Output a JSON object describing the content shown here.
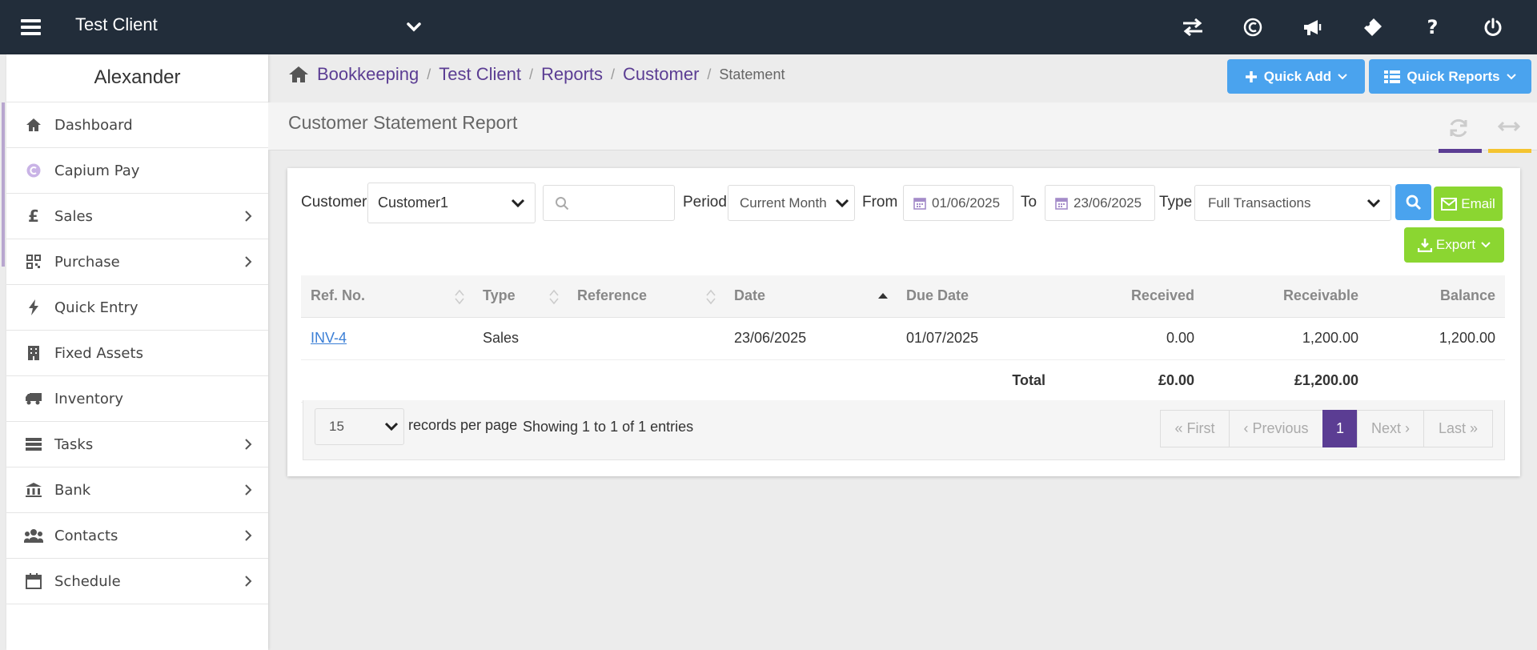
{
  "topbar": {
    "client_name": "Test Client",
    "icons": [
      "switch-icon",
      "capium-icon",
      "announcement-icon",
      "ticket-icon",
      "help-icon",
      "power-icon"
    ]
  },
  "sidebar": {
    "user": "Alexander",
    "items": [
      {
        "label": "Dashboard",
        "icon": "home-icon",
        "has_children": false
      },
      {
        "label": "Capium Pay",
        "icon": "capium-pay-icon",
        "has_children": false
      },
      {
        "label": "Sales",
        "icon": "pound-icon",
        "has_children": true
      },
      {
        "label": "Purchase",
        "icon": "qrcode-icon",
        "has_children": true
      },
      {
        "label": "Quick Entry",
        "icon": "bolt-icon",
        "has_children": false
      },
      {
        "label": "Fixed Assets",
        "icon": "building-icon",
        "has_children": false
      },
      {
        "label": "Inventory",
        "icon": "truck-icon",
        "has_children": false
      },
      {
        "label": "Tasks",
        "icon": "tasks-icon",
        "has_children": true
      },
      {
        "label": "Bank",
        "icon": "bank-icon",
        "has_children": true
      },
      {
        "label": "Contacts",
        "icon": "users-icon",
        "has_children": true
      },
      {
        "label": "Schedule",
        "icon": "calendar-icon",
        "has_children": true
      }
    ]
  },
  "breadcrumb": {
    "items": [
      "Bookkeeping",
      "Test Client",
      "Reports",
      "Customer"
    ],
    "current": "Statement"
  },
  "actions": {
    "quick_add": "Quick Add",
    "quick_reports": "Quick Reports"
  },
  "page": {
    "title": "Customer Statement Report"
  },
  "filters": {
    "customer_label": "Customer",
    "customer_value": "Customer1",
    "search_value": "",
    "period_label": "Period",
    "period_value": "Current Month",
    "from_label": "From",
    "from_value": "01/06/2025",
    "to_label": "To",
    "to_value": "23/06/2025",
    "type_label": "Type",
    "type_value": "Full Transactions",
    "email_label": "Email",
    "export_label": "Export"
  },
  "table": {
    "headers": [
      "Ref. No.",
      "Type",
      "Reference",
      "Date",
      "Due Date",
      "Received",
      "Receivable",
      "Balance"
    ],
    "rows": [
      {
        "ref": "INV-4",
        "type": "Sales",
        "reference": "",
        "date": "23/06/2025",
        "due": "01/07/2025",
        "received": "0.00",
        "receivable": "1,200.00",
        "balance": "1,200.00"
      }
    ],
    "total": {
      "label": "Total",
      "received": "£0.00",
      "receivable": "£1,200.00"
    }
  },
  "pagination": {
    "per_page": "15",
    "per_page_label": "records per page",
    "showing": "Showing 1 to 1 of 1 entries",
    "first": "« First",
    "previous": "‹ Previous",
    "page": "1",
    "next": "Next ›",
    "last": "Last »"
  },
  "colors": {
    "topbar": "#222d3a",
    "brand_purple": "#5b3d93",
    "accent_blue": "#4aa3ee",
    "green": "#8bd631"
  }
}
